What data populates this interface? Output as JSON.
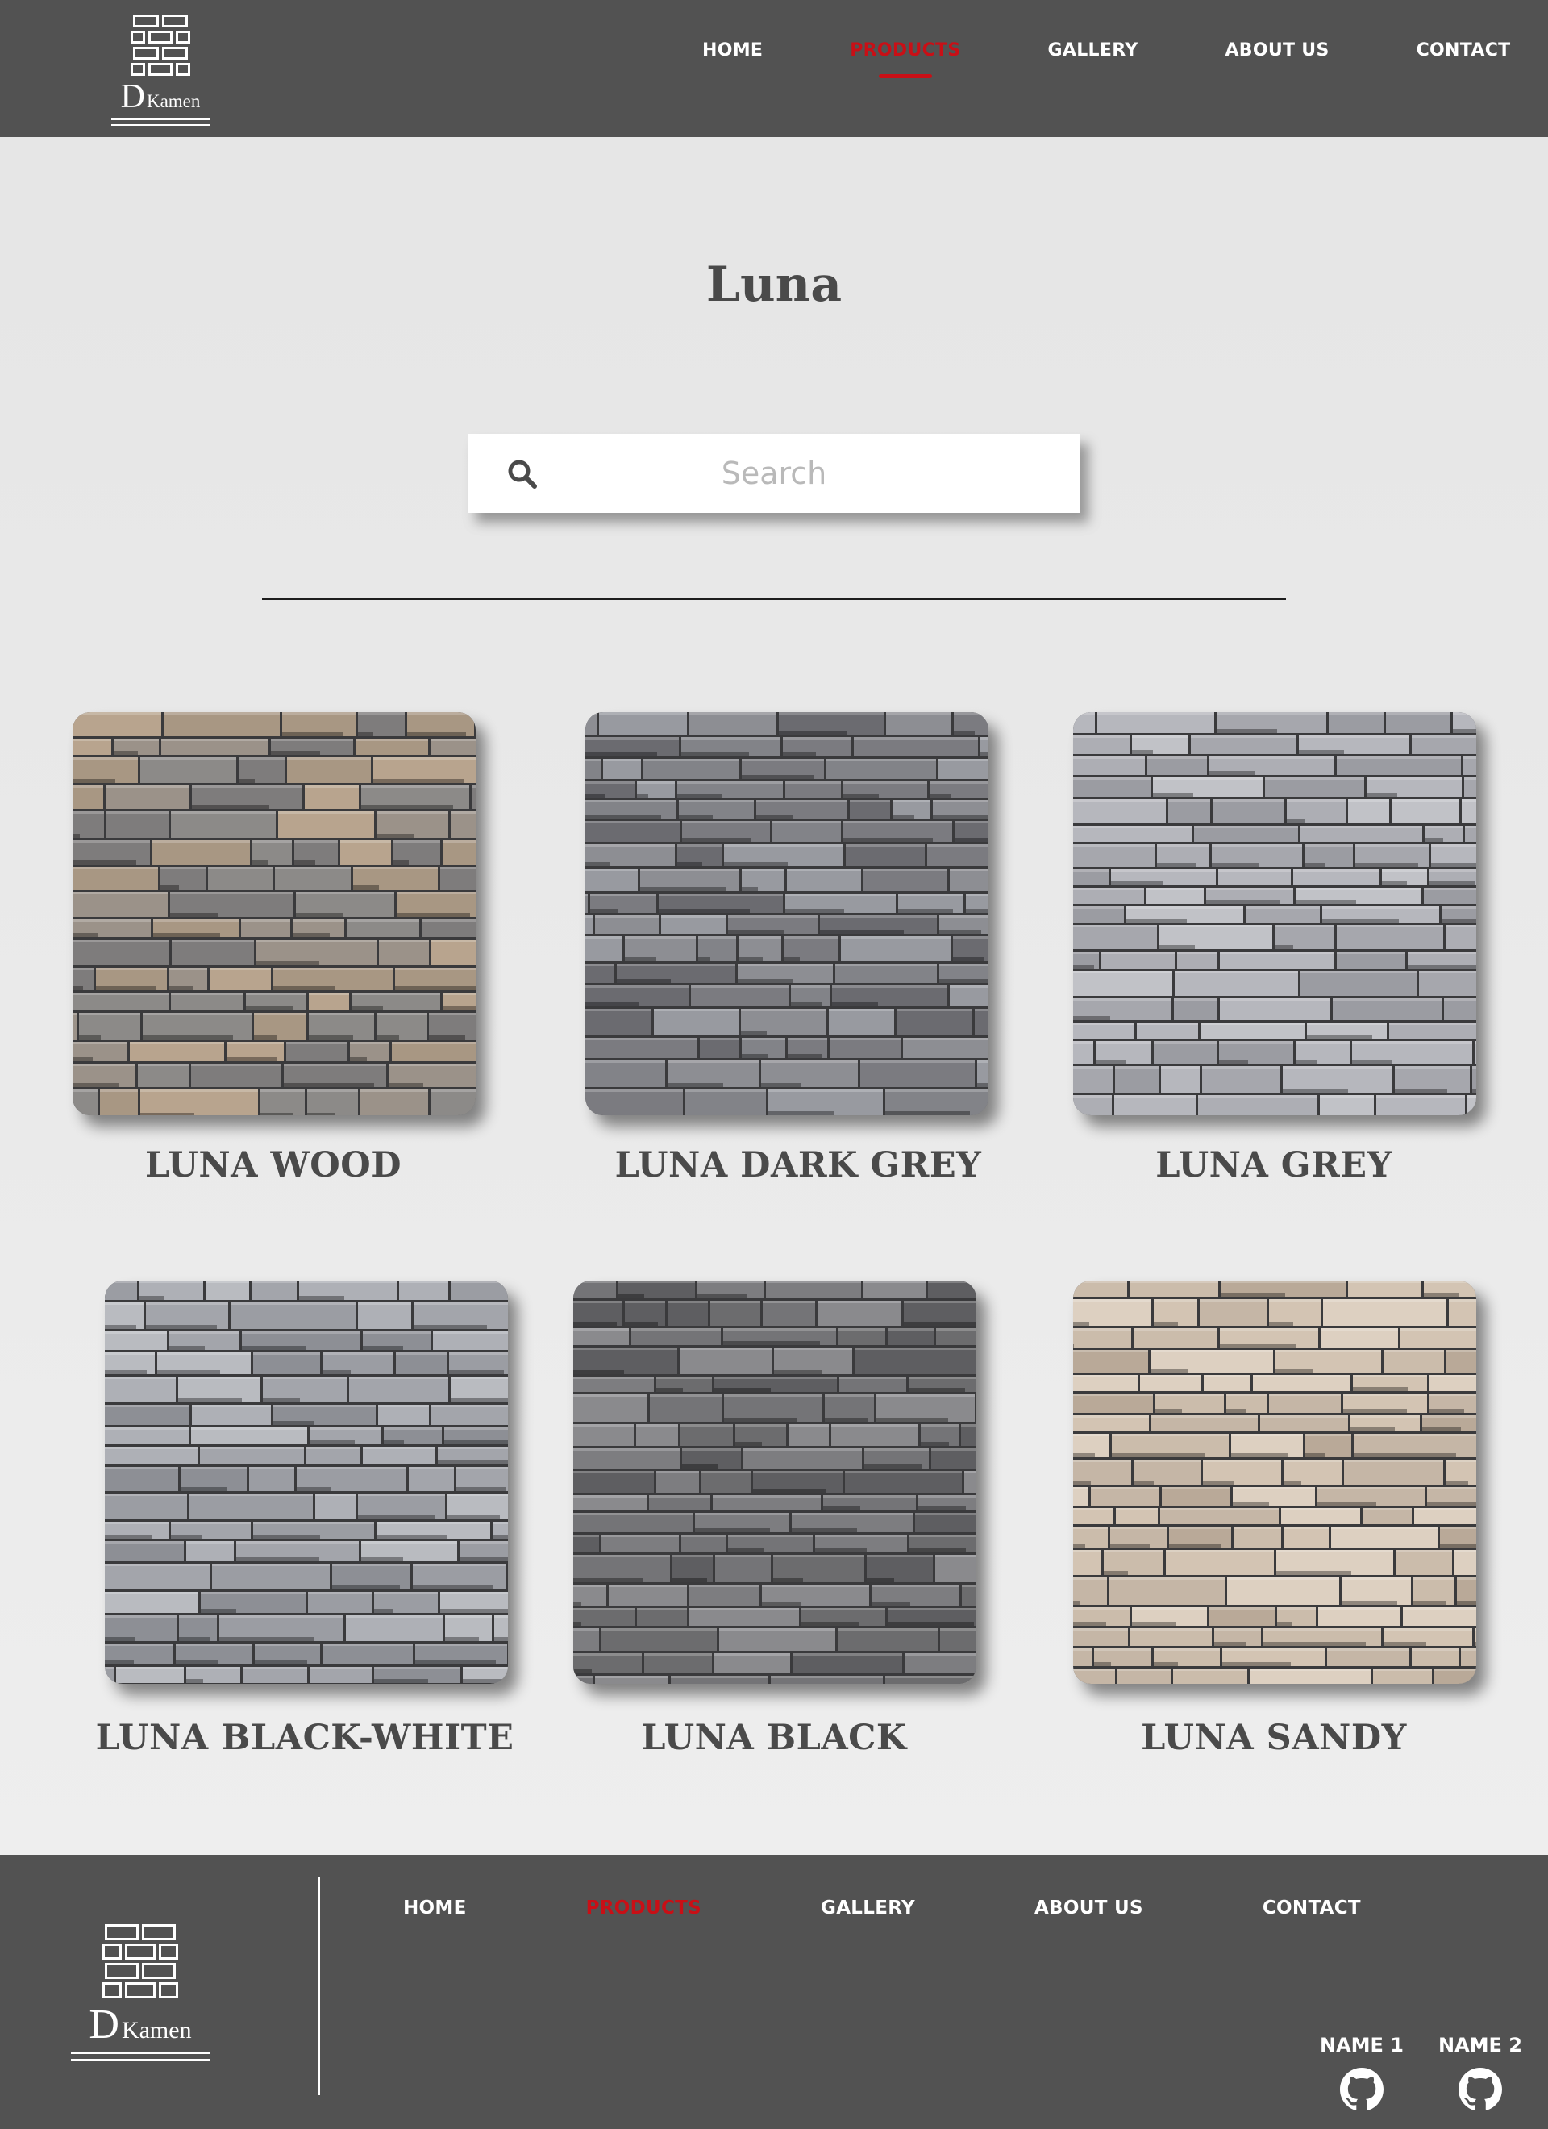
{
  "header": {
    "logo": {
      "letter": "D",
      "word": "Kamen"
    },
    "nav": [
      "HOME",
      "PRODUCTS",
      "GALLERY",
      "ABOUT US",
      "CONTACT"
    ],
    "active_nav": "PRODUCTS"
  },
  "page": {
    "title": "Luna",
    "search": {
      "placeholder": "Search",
      "value": ""
    }
  },
  "products": [
    {
      "name": "LUNA WOOD",
      "tone": [
        "#8c8a88",
        "#a89783",
        "#b8a48e",
        "#7e7c7c",
        "#9b9289"
      ]
    },
    {
      "name": "LUNA DARK GREY",
      "tone": [
        "#7b7b80",
        "#8d8e93",
        "#6b6b70",
        "#989aa0",
        "#828388"
      ]
    },
    {
      "name": "LUNA GREY",
      "tone": [
        "#a6a7ad",
        "#b6b7bd",
        "#9b9ca2",
        "#c1c2c7",
        "#adaeb4"
      ]
    },
    {
      "name": "LUNA BLACK-WHITE",
      "tone": [
        "#9b9da3",
        "#aeb0b6",
        "#8d8f95",
        "#b9bbc0",
        "#a3a5ab"
      ]
    },
    {
      "name": "LUNA BLACK",
      "tone": [
        "#6c6c6e",
        "#7d7d80",
        "#5e5e61",
        "#8a8a8d",
        "#747477"
      ]
    },
    {
      "name": "LUNA SANDY",
      "tone": [
        "#c5b6a6",
        "#d3c4b3",
        "#b9a998",
        "#ddd0c1",
        "#cbbcab"
      ]
    }
  ],
  "footer": {
    "logo": {
      "letter": "D",
      "word": "Kamen"
    },
    "nav": [
      "HOME",
      "PRODUCTS",
      "GALLERY",
      "ABOUT US",
      "CONTACT"
    ],
    "active_nav": "PRODUCTS",
    "contributors": [
      "NAME 1",
      "NAME 2"
    ]
  },
  "colors": {
    "header_bg": "#525252",
    "active": "#c90f16",
    "page_bg": "#e8e8e8"
  },
  "icons": [
    "search-icon",
    "github-icon",
    "brick-logo-icon"
  ]
}
